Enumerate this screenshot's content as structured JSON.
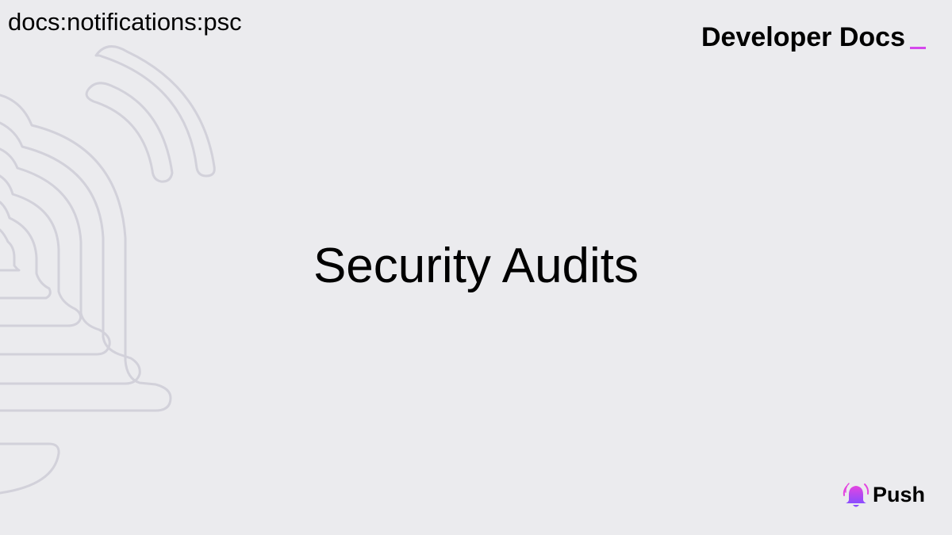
{
  "header": {
    "doc_id": "docs:notifications:psc",
    "brand": "Developer Docs"
  },
  "main": {
    "title": "Security Audits"
  },
  "footer": {
    "logo_text": "Push"
  },
  "icons": {
    "background": "bell-outline-icon",
    "logo": "bell-icon"
  },
  "colors": {
    "background": "#ebebee",
    "outline": "#d2d1da",
    "accent": "#d548ec",
    "logo_gradient_top": "#e445e0",
    "logo_gradient_bottom": "#8a4cff"
  }
}
